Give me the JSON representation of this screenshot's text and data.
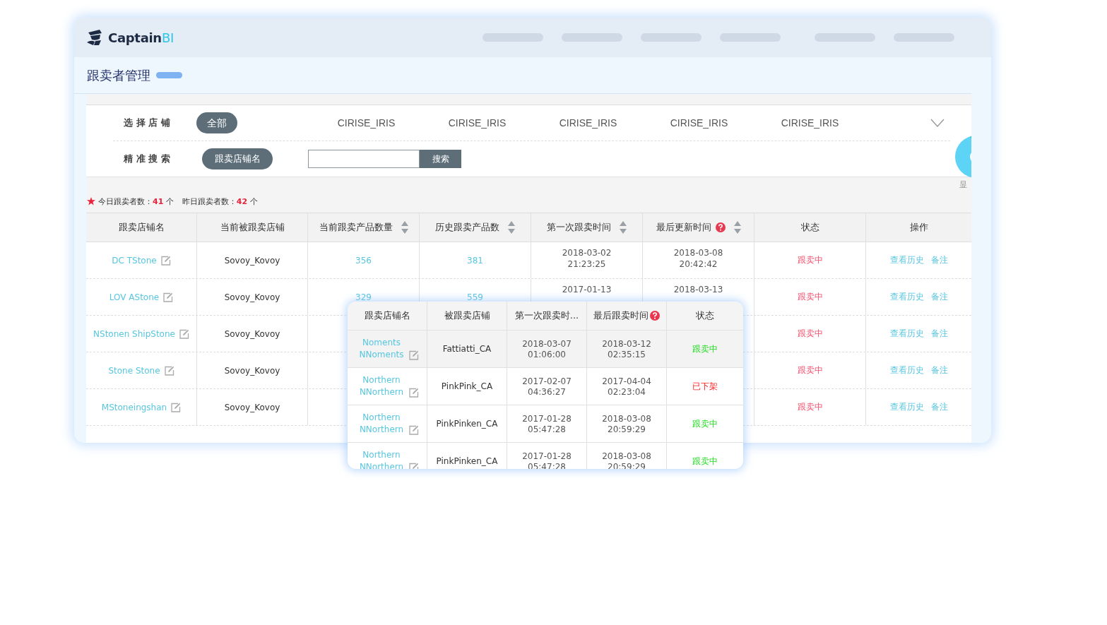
{
  "brand": {
    "name": "Captain",
    "suffix": "BI"
  },
  "page_title": "跟卖者管理",
  "store_filter": {
    "label": "选 择 店 铺",
    "options": [
      {
        "label": "全部",
        "selected": true
      },
      {
        "label": "CIRISE_IRIS",
        "selected": false
      },
      {
        "label": "CIRISE_IRIS",
        "selected": false
      },
      {
        "label": "CIRISE_IRIS",
        "selected": false
      },
      {
        "label": "CIRISE_IRIS",
        "selected": false
      },
      {
        "label": "CIRISE_IRIS",
        "selected": false
      }
    ]
  },
  "search": {
    "label": "精 准 搜 索",
    "type": "跟卖店铺名",
    "button": "搜索"
  },
  "side_label": "显",
  "stats": [
    {
      "label": "今日跟卖者数：",
      "value": "41",
      "unit": "个"
    },
    {
      "label": "昨日跟卖者数：",
      "value": "42",
      "unit": "个"
    }
  ],
  "table": {
    "columns": [
      {
        "label": "跟卖店铺名",
        "sortable": false,
        "help": false
      },
      {
        "label": "当前被跟卖店铺",
        "sortable": false,
        "help": false
      },
      {
        "label": "当前跟卖产品数量",
        "sortable": true,
        "help": false
      },
      {
        "label": "历史跟卖产品数",
        "sortable": true,
        "help": false
      },
      {
        "label": "第一次跟卖时间",
        "sortable": true,
        "help": false
      },
      {
        "label": "最后更新时间",
        "sortable": true,
        "help": true
      },
      {
        "label": "状态",
        "sortable": false,
        "help": false
      },
      {
        "label": "操作",
        "sortable": false,
        "help": false
      }
    ],
    "rows": [
      {
        "name": "DC TStone",
        "target": "Sovoy_Kovoy",
        "current": "356",
        "history": "381",
        "first": [
          "2018-03-02",
          "21:23:25"
        ],
        "last": [
          "2018-03-08",
          "20:42:42"
        ],
        "status": {
          "kind": "following",
          "text": "跟卖中"
        },
        "actions": [
          "查看历史",
          "备注"
        ]
      },
      {
        "name": "LOV AStone",
        "target": "Sovoy_Kovoy",
        "current": "329",
        "history": "559",
        "first": [
          "2017-01-13"
        ],
        "last": [
          "2018-03-13"
        ],
        "status": {
          "kind": "following",
          "text": "跟卖中"
        },
        "actions": [
          "查看历史",
          "备注"
        ]
      },
      {
        "name": "NStonen ShipStone",
        "target": "Sovoy_Kovoy",
        "status": {
          "kind": "following",
          "text": "跟卖中"
        },
        "actions": [
          "查看历史",
          "备注"
        ]
      },
      {
        "name": "Stone Stone",
        "target": "Sovoy_Kovoy",
        "status": {
          "kind": "following",
          "text": "跟卖中"
        },
        "actions": [
          "查看历史",
          "备注"
        ]
      },
      {
        "name": "MStoneingshan",
        "target": "Sovoy_Kovoy",
        "status": {
          "kind": "following",
          "text": "跟卖中"
        },
        "actions": [
          "查看历史",
          "备注"
        ]
      }
    ]
  },
  "popup": {
    "columns": [
      {
        "label": "跟卖店铺名",
        "help": false
      },
      {
        "label": "被跟卖店铺",
        "help": false
      },
      {
        "label": "第一次跟卖时...",
        "help": false
      },
      {
        "label": "最后跟卖时间",
        "help": true
      },
      {
        "label": "状态",
        "help": false
      }
    ],
    "rows": [
      {
        "selected": true,
        "name": "Noments NNoments",
        "target": "Fattiatti_CA",
        "first": [
          "2018-03-07",
          "01:06:00"
        ],
        "last": [
          "2018-03-12",
          "02:35:15"
        ],
        "status": {
          "kind": "following",
          "text": "跟卖中"
        }
      },
      {
        "selected": false,
        "name": "Northern NNorthern",
        "target": "PinkPink_CA",
        "first": [
          "2017-02-07",
          "04:36:27"
        ],
        "last": [
          "2017-04-04",
          "02:23:04"
        ],
        "status": {
          "kind": "delisted",
          "text": "已下架"
        }
      },
      {
        "selected": false,
        "name": "Northern NNorthern",
        "target": "PinkPinken_CA",
        "first": [
          "2017-01-28",
          "05:47:28"
        ],
        "last": [
          "2018-03-08",
          "20:59:29"
        ],
        "status": {
          "kind": "following",
          "text": "跟卖中"
        }
      },
      {
        "selected": false,
        "name": "Northern NNorthern",
        "target": "PinkPinken_CA",
        "first": [
          "2017-01-28",
          "05:47:28"
        ],
        "last": [
          "2018-03-08",
          "20:59:29"
        ],
        "status": {
          "kind": "following",
          "text": "跟卖中"
        }
      }
    ]
  }
}
